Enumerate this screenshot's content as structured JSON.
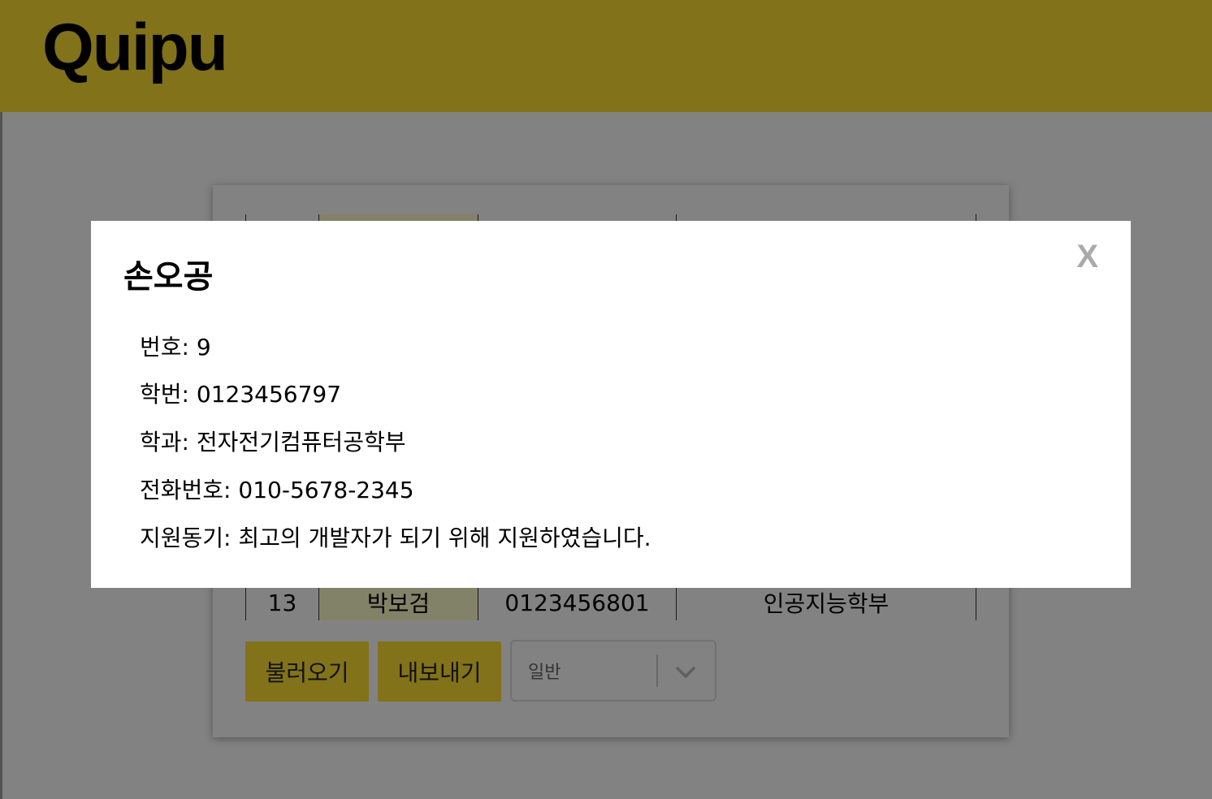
{
  "header": {
    "logo": "Quipu",
    "color": "#FFE033"
  },
  "table": {
    "rows": [
      {
        "num": "13",
        "name": "박보검",
        "student_id": "0123456801",
        "dept": "인공지능학부"
      }
    ]
  },
  "actions": {
    "load_label": "불러오기",
    "export_label": "내보내기",
    "filter_value": "일반"
  },
  "modal": {
    "title": "손오공",
    "close_label": "X",
    "fields": [
      {
        "label": "번호",
        "value": "9"
      },
      {
        "label": "학번",
        "value": "0123456797"
      },
      {
        "label": "학과",
        "value": "전자전기컴퓨터공학부"
      },
      {
        "label": "전화번호",
        "value": "010-5678-2345"
      },
      {
        "label": "지원동기",
        "value": "최고의 개발자가 되기 위해 지원하였습니다."
      }
    ]
  }
}
